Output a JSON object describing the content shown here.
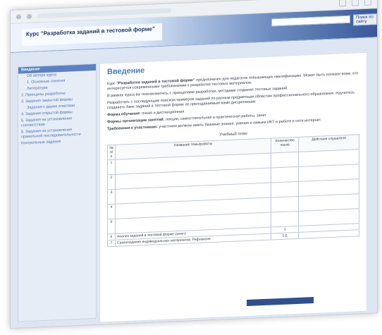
{
  "header": {
    "title": "Курс \"Разработка заданий в тестовой форме\"",
    "search_button": "Поиск по сайту"
  },
  "sidebar": {
    "items": [
      {
        "label": "Введение",
        "active": true
      },
      {
        "label": "Об авторе курса"
      },
      {
        "label": "1. Основные понятия",
        "sub": true
      },
      {
        "label": "Литература",
        "sub": true
      },
      {
        "label": "2. Принципы разработки"
      },
      {
        "label": "3. Задания закрытой формы"
      },
      {
        "label": "Задания с двумя ответами",
        "sub": true
      },
      {
        "label": "4. Задания открытой формы"
      },
      {
        "label": "5. Задания на установление соответствия"
      },
      {
        "label": "6. Задания на установление правильной последовательности"
      },
      {
        "label": "Контрольные задания"
      }
    ]
  },
  "content": {
    "heading": "Введение",
    "intro_prefix": "Курс ",
    "intro_course": "\"Разработка заданий в тестовой форме\"",
    "intro_suffix": " предназначен для педагогов повышающих квалификацию. Может быть полезен всем, кто интересуется современными требованиями к разработке тестовых материалов.",
    "p2": "В рамках курса вы познакомитесь с принципами разработки, методами создания тестовых заданий.",
    "p3": "Разработать с последующим поиском примеров заданий по разным предметным областям профессионального образования. Научитесь создавать банк заданий в тестовой форме по преподаваемым вами дисциплинам.",
    "form_label": "Форма обучения:",
    "form_value": " очная и дистанционная",
    "org_label": "Формы организации занятий:",
    "org_value": " лекции, самостоятельная и практическая работы, зачет",
    "req_label": "Требования к участникам:",
    "req_value": " участники должны иметь базовые знания, умения и навыки ИКТ в работе в сети интернет.",
    "plan_title": "Учебный план",
    "table": {
      "headers": [
        "№ п/п",
        "Название темы/работы",
        "Количество часов",
        "Действия слушателя"
      ],
      "rows": [
        {
          "no": "1",
          "name": "",
          "hours": "",
          "actions": ""
        },
        {
          "no": "2",
          "name": "",
          "hours": "",
          "actions": ""
        },
        {
          "no": "3",
          "name": "",
          "hours": "",
          "actions": ""
        },
        {
          "no": "4",
          "name": "",
          "hours": "",
          "actions": ""
        },
        {
          "no": "5",
          "name": "",
          "hours": "",
          "actions": ""
        },
        {
          "no": "6",
          "name": "Анализ заданий в тестовой форме (зачет)",
          "hours": "1",
          "actions": ""
        },
        {
          "no": "7",
          "name": "Самоcоздание индивидуальных материалов. Рефлексия",
          "hours": "0,5",
          "actions": ""
        }
      ]
    }
  }
}
